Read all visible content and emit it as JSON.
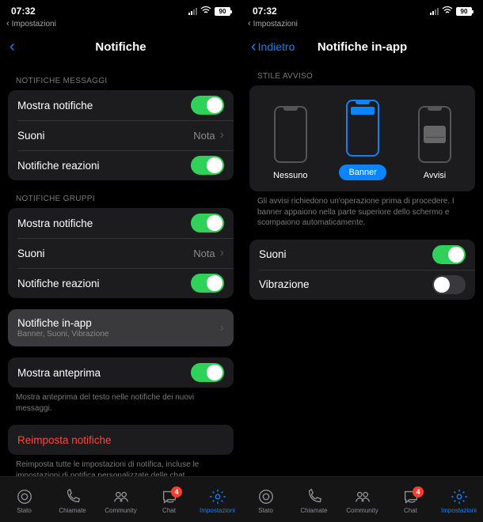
{
  "status": {
    "time": "07:32",
    "battery": "90"
  },
  "breadcrumb": {
    "backApp": "Impostazioni"
  },
  "left": {
    "title": "Notifiche",
    "sections": {
      "messages": {
        "label": "NOTIFICHE MESSAGGI",
        "showNotifications": "Mostra notifiche",
        "sounds": "Suoni",
        "soundsValue": "Nota",
        "reactions": "Notifiche reazioni"
      },
      "groups": {
        "label": "NOTIFICHE GRUPPI",
        "showNotifications": "Mostra notifiche",
        "sounds": "Suoni",
        "soundsValue": "Nota",
        "reactions": "Notifiche reazioni"
      },
      "inApp": {
        "title": "Notifiche in-app",
        "subtitle": "Banner, Suoni, Vibrazione"
      },
      "preview": {
        "label": "Mostra anteprima",
        "note": "Mostra anteprima del testo nelle notifiche dei nuovi messaggi."
      },
      "reset": {
        "label": "Reimposta notifiche",
        "note": "Reimposta tutte le impostazioni di notifica, incluse le impostazioni di notifica personalizzate delle chat."
      }
    }
  },
  "right": {
    "back": "Indietro",
    "title": "Notifiche in-app",
    "styleLabel": "STILE AVVISO",
    "styles": {
      "none": "Nessuno",
      "banner": "Banner",
      "alerts": "Avvisi"
    },
    "styleNote": "Gli avvisi richiedono un'operazione prima di procedere. I banner appaiono nella parte superiore dello schermo e scompaiono automaticamente.",
    "sounds": "Suoni",
    "vibration": "Vibrazione"
  },
  "tabs": {
    "status": "Stato",
    "calls": "Chiamate",
    "community": "Community",
    "chat": "Chat",
    "settings": "Impostazioni",
    "chatBadge": "4"
  }
}
